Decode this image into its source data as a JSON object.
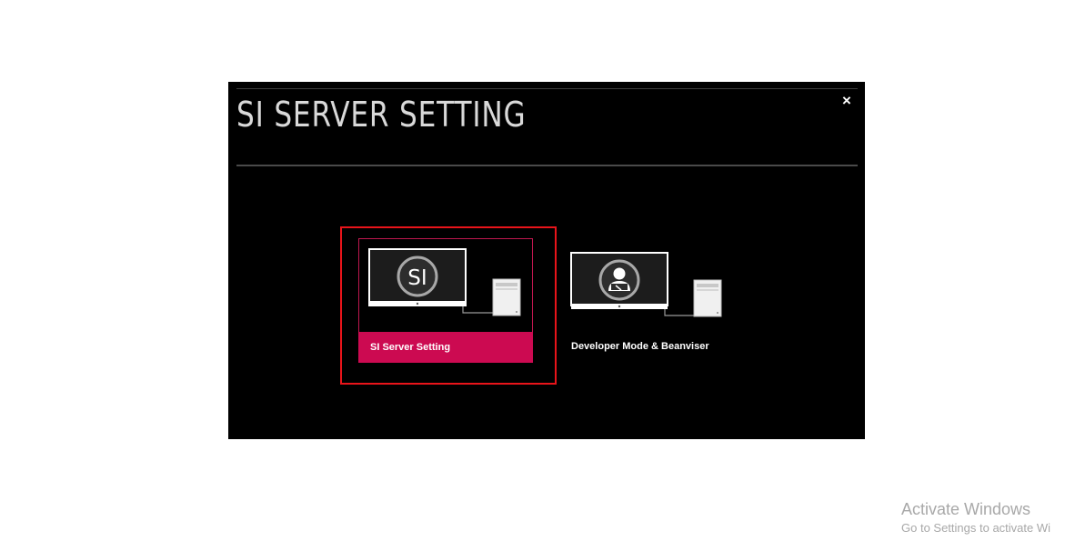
{
  "dialog": {
    "title": "SI SERVER SETTING",
    "close_label": "×"
  },
  "options": [
    {
      "id": "si-server-setting",
      "label": "SI Server Setting",
      "icon_text": "SI",
      "icon": "si-server-icon",
      "selected": true
    },
    {
      "id": "developer-mode",
      "label": "Developer Mode & Beanviser",
      "icon": "developer-person-icon",
      "selected": false
    }
  ],
  "colors": {
    "selected_bar": "#cc0a51",
    "highlight_frame": "#e8141a",
    "panel_bg": "#000000"
  },
  "watermark": {
    "title": "Activate Windows",
    "subtitle": "Go to Settings to activate Wi"
  }
}
